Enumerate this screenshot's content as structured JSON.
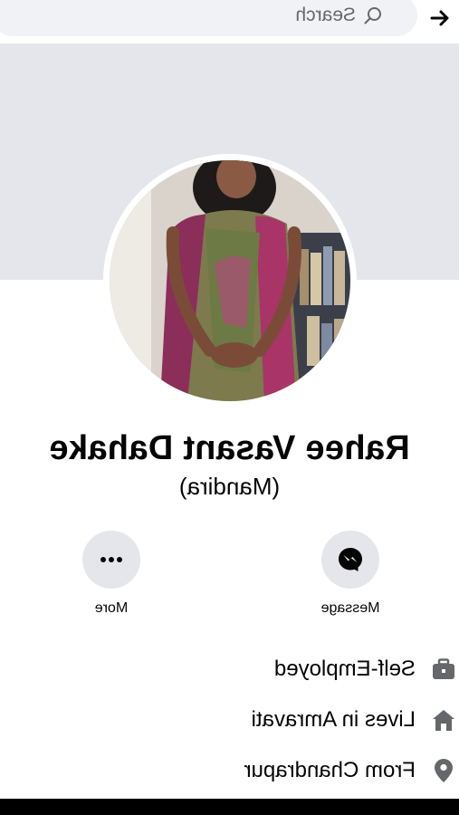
{
  "header": {
    "search_placeholder": "Search",
    "back_icon": "arrow-left-icon"
  },
  "profile": {
    "name": "Rahee Vasant Dahake",
    "alternate_name": "(Mandira)"
  },
  "actions": [
    {
      "label": "Message",
      "icon": "messenger-icon"
    },
    {
      "label": "More",
      "icon": "more-dots-icon"
    }
  ],
  "details": [
    {
      "text": "Self-Employed",
      "icon": "briefcase-icon"
    },
    {
      "text": "Lives in Amravati",
      "icon": "home-icon"
    },
    {
      "text": "From Chandrapur",
      "icon": "location-pin-icon"
    }
  ],
  "colors": {
    "cover": "#e4e6eb",
    "button_bg": "#e4e6eb",
    "icon_grey": "#65676b",
    "text": "#050505"
  }
}
